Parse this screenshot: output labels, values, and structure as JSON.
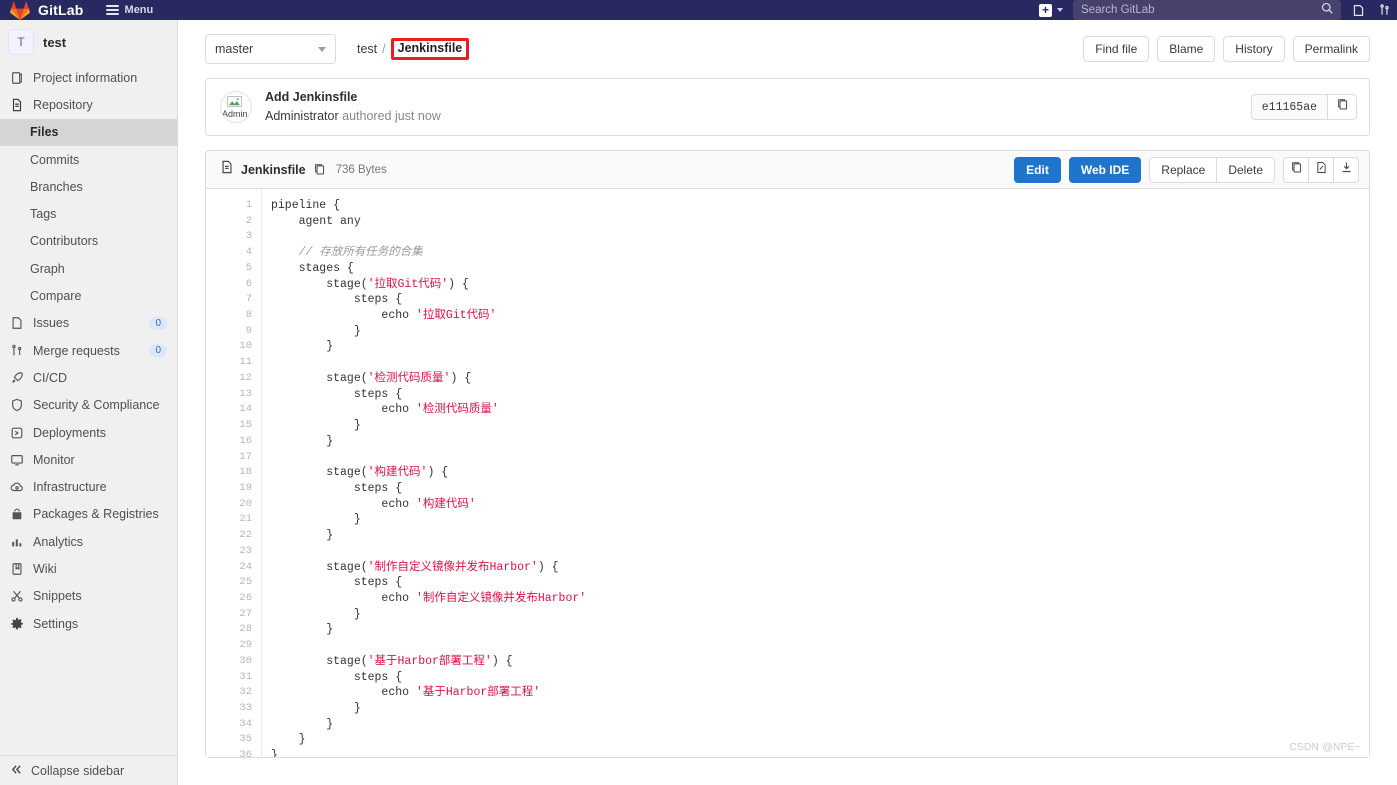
{
  "topnav": {
    "brand": "GitLab",
    "logo_icon": "gitlab-tanuki-icon",
    "menu_label": "Menu",
    "hamburger_icon": "hamburger-icon",
    "plus_icon": "plus-icon",
    "plus_caret_icon": "chevron-down-icon",
    "search_placeholder": "Search GitLab",
    "search_value": "",
    "search_icon": "search-icon",
    "issues_icon": "issues-icon",
    "merge_requests_icon": "merge-request-icon",
    "brand_color": "#292961"
  },
  "sidebar": {
    "project_initial": "T",
    "project_name": "test",
    "items": [
      {
        "label": "Project information",
        "icon": "project-information-icon",
        "badge": ""
      },
      {
        "label": "Repository",
        "icon": "repository-icon",
        "badge": ""
      }
    ],
    "repository_sub_items": [
      {
        "label": "Files",
        "active": true
      },
      {
        "label": "Commits",
        "active": false
      },
      {
        "label": "Branches",
        "active": false
      },
      {
        "label": "Tags",
        "active": false
      },
      {
        "label": "Contributors",
        "active": false
      },
      {
        "label": "Graph",
        "active": false
      },
      {
        "label": "Compare",
        "active": false
      }
    ],
    "lower_items": [
      {
        "label": "Issues",
        "icon": "issues-icon",
        "badge": "0"
      },
      {
        "label": "Merge requests",
        "icon": "merge-request-icon",
        "badge": "0"
      },
      {
        "label": "CI/CD",
        "icon": "rocket-icon",
        "badge": ""
      },
      {
        "label": "Security & Compliance",
        "icon": "shield-icon",
        "badge": ""
      },
      {
        "label": "Deployments",
        "icon": "deployments-icon",
        "badge": ""
      },
      {
        "label": "Monitor",
        "icon": "monitor-icon",
        "badge": ""
      },
      {
        "label": "Infrastructure",
        "icon": "cloud-icon",
        "badge": ""
      },
      {
        "label": "Packages & Registries",
        "icon": "package-icon",
        "badge": ""
      },
      {
        "label": "Analytics",
        "icon": "chart-icon",
        "badge": ""
      },
      {
        "label": "Wiki",
        "icon": "book-icon",
        "badge": ""
      },
      {
        "label": "Snippets",
        "icon": "scissors-icon",
        "badge": ""
      },
      {
        "label": "Settings",
        "icon": "gear-icon",
        "badge": ""
      }
    ],
    "collapse_label": "Collapse sidebar",
    "collapse_icon": "chevron-double-left-icon"
  },
  "file_header": {
    "branch": "master",
    "branch_caret_icon": "chevron-down-icon",
    "breadcrumb_root": "test",
    "breadcrumb_separator": "/",
    "breadcrumb_current": "Jenkinsfile",
    "highlight_color": "#ec1c24",
    "actions": [
      {
        "label": "Find file"
      },
      {
        "label": "Blame"
      },
      {
        "label": "History"
      },
      {
        "label": "Permalink"
      }
    ]
  },
  "commit": {
    "avatar_alt": "Admin",
    "title": "Add Jenkinsfile",
    "author": "Administrator",
    "meta": "authored just now",
    "sha": "e11165ae",
    "copy_icon": "copy-icon"
  },
  "blob": {
    "file_icon": "document-icon",
    "file_name": "Jenkinsfile",
    "copy_path_icon": "copy-icon",
    "size": "736 Bytes",
    "primary_actions": [
      {
        "label": "Edit"
      },
      {
        "label": "Web IDE"
      }
    ],
    "secondary_actions": [
      {
        "label": "Replace"
      },
      {
        "label": "Delete"
      }
    ],
    "icon_actions": [
      {
        "icon": "copy-icon"
      },
      {
        "icon": "open-raw-icon"
      },
      {
        "icon": "download-icon"
      }
    ],
    "lines": [
      {
        "n": 1,
        "tokens": [
          {
            "t": "pipeline {",
            "c": ""
          }
        ]
      },
      {
        "n": 2,
        "tokens": [
          {
            "t": "    agent any",
            "c": ""
          }
        ]
      },
      {
        "n": 3,
        "tokens": [
          {
            "t": "",
            "c": ""
          }
        ]
      },
      {
        "n": 4,
        "tokens": [
          {
            "t": "    ",
            "c": ""
          },
          {
            "t": "// 存放所有任务的合集",
            "c": "tok-com"
          }
        ]
      },
      {
        "n": 5,
        "tokens": [
          {
            "t": "    stages {",
            "c": ""
          }
        ]
      },
      {
        "n": 6,
        "tokens": [
          {
            "t": "        stage(",
            "c": ""
          },
          {
            "t": "'拉取Git代码'",
            "c": "tok-str"
          },
          {
            "t": ") {",
            "c": ""
          }
        ]
      },
      {
        "n": 7,
        "tokens": [
          {
            "t": "            steps {",
            "c": ""
          }
        ]
      },
      {
        "n": 8,
        "tokens": [
          {
            "t": "                echo ",
            "c": ""
          },
          {
            "t": "'拉取Git代码'",
            "c": "tok-str"
          }
        ]
      },
      {
        "n": 9,
        "tokens": [
          {
            "t": "            }",
            "c": ""
          }
        ]
      },
      {
        "n": 10,
        "tokens": [
          {
            "t": "        }",
            "c": ""
          }
        ]
      },
      {
        "n": 11,
        "tokens": [
          {
            "t": "",
            "c": ""
          }
        ]
      },
      {
        "n": 12,
        "tokens": [
          {
            "t": "        stage(",
            "c": ""
          },
          {
            "t": "'检测代码质量'",
            "c": "tok-str"
          },
          {
            "t": ") {",
            "c": ""
          }
        ]
      },
      {
        "n": 13,
        "tokens": [
          {
            "t": "            steps {",
            "c": ""
          }
        ]
      },
      {
        "n": 14,
        "tokens": [
          {
            "t": "                echo ",
            "c": ""
          },
          {
            "t": "'检测代码质量'",
            "c": "tok-str"
          }
        ]
      },
      {
        "n": 15,
        "tokens": [
          {
            "t": "            }",
            "c": ""
          }
        ]
      },
      {
        "n": 16,
        "tokens": [
          {
            "t": "        }",
            "c": ""
          }
        ]
      },
      {
        "n": 17,
        "tokens": [
          {
            "t": "",
            "c": ""
          }
        ]
      },
      {
        "n": 18,
        "tokens": [
          {
            "t": "        stage(",
            "c": ""
          },
          {
            "t": "'构建代码'",
            "c": "tok-str"
          },
          {
            "t": ") {",
            "c": ""
          }
        ]
      },
      {
        "n": 19,
        "tokens": [
          {
            "t": "            steps {",
            "c": ""
          }
        ]
      },
      {
        "n": 20,
        "tokens": [
          {
            "t": "                echo ",
            "c": ""
          },
          {
            "t": "'构建代码'",
            "c": "tok-str"
          }
        ]
      },
      {
        "n": 21,
        "tokens": [
          {
            "t": "            }",
            "c": ""
          }
        ]
      },
      {
        "n": 22,
        "tokens": [
          {
            "t": "        }",
            "c": ""
          }
        ]
      },
      {
        "n": 23,
        "tokens": [
          {
            "t": "",
            "c": ""
          }
        ]
      },
      {
        "n": 24,
        "tokens": [
          {
            "t": "        stage(",
            "c": ""
          },
          {
            "t": "'制作自定义镜像并发布Harbor'",
            "c": "tok-str"
          },
          {
            "t": ") {",
            "c": ""
          }
        ]
      },
      {
        "n": 25,
        "tokens": [
          {
            "t": "            steps {",
            "c": ""
          }
        ]
      },
      {
        "n": 26,
        "tokens": [
          {
            "t": "                echo ",
            "c": ""
          },
          {
            "t": "'制作自定义镜像并发布Harbor'",
            "c": "tok-str"
          }
        ]
      },
      {
        "n": 27,
        "tokens": [
          {
            "t": "            }",
            "c": ""
          }
        ]
      },
      {
        "n": 28,
        "tokens": [
          {
            "t": "        }",
            "c": ""
          }
        ]
      },
      {
        "n": 29,
        "tokens": [
          {
            "t": "",
            "c": ""
          }
        ]
      },
      {
        "n": 30,
        "tokens": [
          {
            "t": "        stage(",
            "c": ""
          },
          {
            "t": "'基于Harbor部署工程'",
            "c": "tok-str"
          },
          {
            "t": ") {",
            "c": ""
          }
        ]
      },
      {
        "n": 31,
        "tokens": [
          {
            "t": "            steps {",
            "c": ""
          }
        ]
      },
      {
        "n": 32,
        "tokens": [
          {
            "t": "                echo ",
            "c": ""
          },
          {
            "t": "'基于Harbor部署工程'",
            "c": "tok-str"
          }
        ]
      },
      {
        "n": 33,
        "tokens": [
          {
            "t": "            }",
            "c": ""
          }
        ]
      },
      {
        "n": 34,
        "tokens": [
          {
            "t": "        }",
            "c": ""
          }
        ]
      },
      {
        "n": 35,
        "tokens": [
          {
            "t": "    }",
            "c": ""
          }
        ]
      },
      {
        "n": 36,
        "tokens": [
          {
            "t": "}",
            "c": ""
          }
        ]
      }
    ]
  },
  "watermark": {
    "text": "CSDN @NPE~"
  }
}
